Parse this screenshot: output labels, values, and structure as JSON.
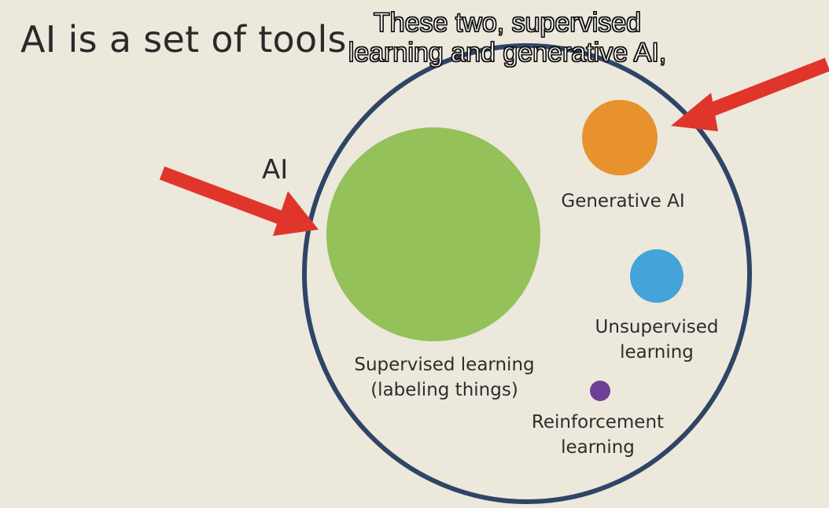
{
  "slide": {
    "title": "AI is a set of tools",
    "caption_line1": "These two, supervised",
    "caption_line2": "learning and generative AI,",
    "outer_circle_label": "AI",
    "items": [
      {
        "label_line1": "Supervised learning",
        "label_line2": "(labeling things)",
        "color": "#94c15a"
      },
      {
        "label_line1": "Generative AI",
        "label_line2": "",
        "color": "#e8912f"
      },
      {
        "label_line1": "Unsupervised",
        "label_line2": "learning",
        "color": "#44a3d8"
      },
      {
        "label_line1": "Reinforcement",
        "label_line2": "learning",
        "color": "#6e3f94"
      }
    ],
    "colors": {
      "background": "#ede8dc",
      "outer_circle": "#2e4566",
      "arrow": "#e0352b"
    }
  }
}
